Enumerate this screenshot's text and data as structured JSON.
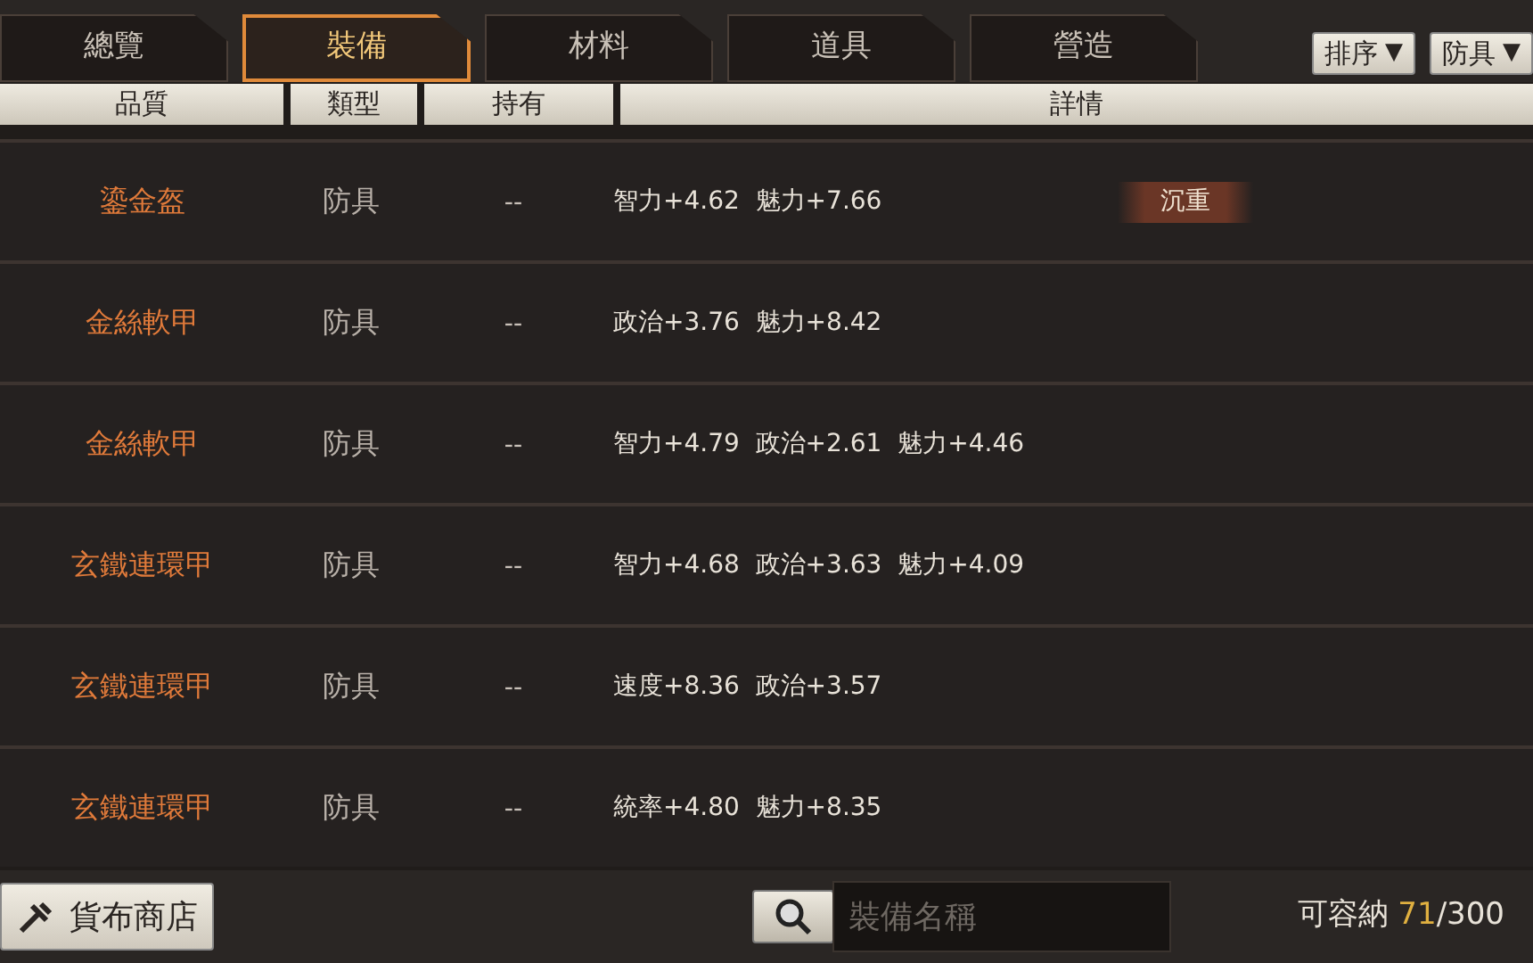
{
  "tabs": [
    {
      "label": "總覽",
      "selected": false
    },
    {
      "label": "裝備",
      "selected": true
    },
    {
      "label": "材料",
      "selected": false
    },
    {
      "label": "道具",
      "selected": false
    },
    {
      "label": "營造",
      "selected": false
    }
  ],
  "dropdowns": [
    {
      "label": "排序",
      "caret": "▼"
    },
    {
      "label": "防具",
      "caret": "▼"
    }
  ],
  "table": {
    "columns": [
      "品質",
      "類型",
      "持有",
      "詳情"
    ],
    "rows": [
      {
        "name": "鎏金盔",
        "type": "防具",
        "owned": "--",
        "stats": "智力+4.62  魅力+7.66",
        "tag": "沉重"
      },
      {
        "name": "金絲軟甲",
        "type": "防具",
        "owned": "--",
        "stats": "政治+3.76  魅力+8.42"
      },
      {
        "name": "金絲軟甲",
        "type": "防具",
        "owned": "--",
        "stats": "智力+4.79  政治+2.61  魅力+4.46"
      },
      {
        "name": "玄鐵連環甲",
        "type": "防具",
        "owned": "--",
        "stats": "智力+4.68  政治+3.63  魅力+4.09"
      },
      {
        "name": "玄鐵連環甲",
        "type": "防具",
        "owned": "--",
        "stats": "速度+8.36  政治+3.57"
      },
      {
        "name": "玄鐵連環甲",
        "type": "防具",
        "owned": "--",
        "stats": "統率+4.80  魅力+8.35"
      }
    ]
  },
  "footer": {
    "shop_button": "貨布商店",
    "search": {
      "placeholder": "裝備名稱"
    },
    "capacity": {
      "label": "可容納",
      "count": "71",
      "total": "/300"
    }
  }
}
